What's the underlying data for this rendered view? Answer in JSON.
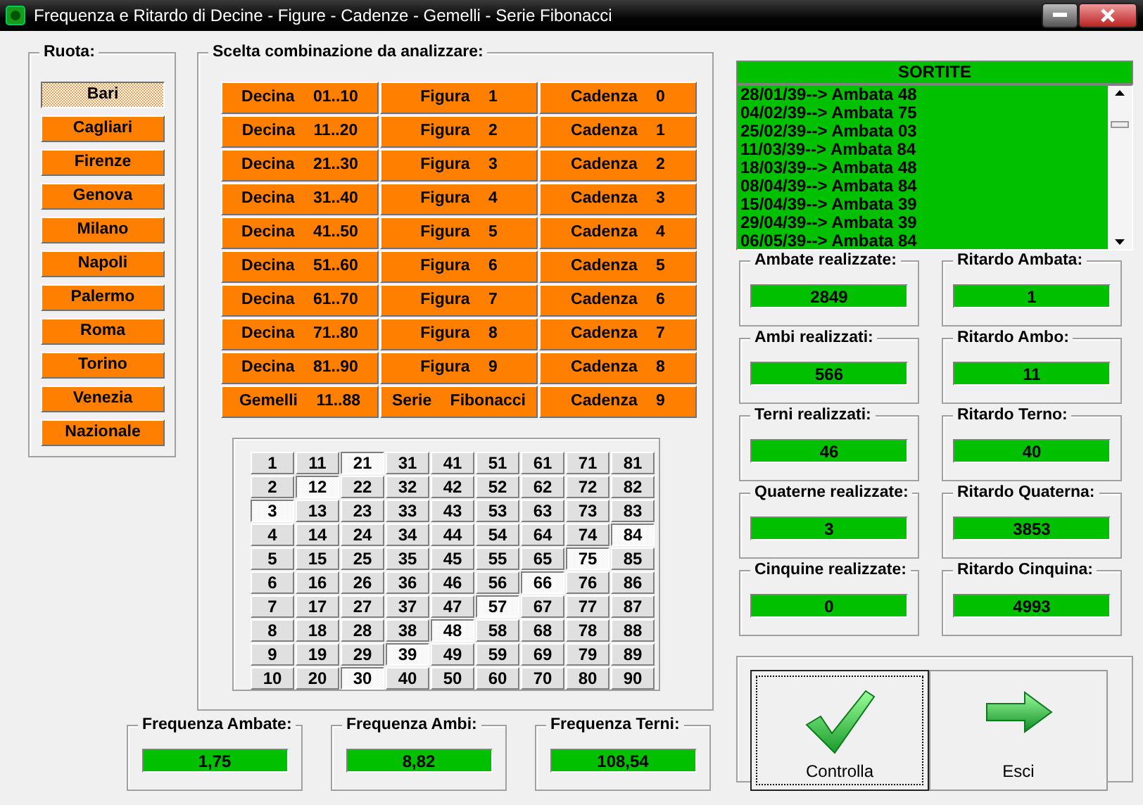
{
  "window": {
    "title": "Frequenza e Ritardo di Decine - Figure - Cadenze - Gemelli - Serie Fibonacci"
  },
  "ruota": {
    "label": "Ruota:",
    "items": [
      {
        "label": "Bari",
        "selected": true
      },
      {
        "label": "Cagliari",
        "selected": false
      },
      {
        "label": "Firenze",
        "selected": false
      },
      {
        "label": "Genova",
        "selected": false
      },
      {
        "label": "Milano",
        "selected": false
      },
      {
        "label": "Napoli",
        "selected": false
      },
      {
        "label": "Palermo",
        "selected": false
      },
      {
        "label": "Roma",
        "selected": false
      },
      {
        "label": "Torino",
        "selected": false
      },
      {
        "label": "Venezia",
        "selected": false
      },
      {
        "label": "Nazionale",
        "selected": false
      }
    ]
  },
  "scelta": {
    "label": "Scelta combinazione da analizzare:",
    "rows": [
      [
        "Decina 01..10",
        "Figura 1",
        "Cadenza 0"
      ],
      [
        "Decina 11..20",
        "Figura 2",
        "Cadenza 1"
      ],
      [
        "Decina 21..30",
        "Figura 3",
        "Cadenza 2"
      ],
      [
        "Decina 31..40",
        "Figura 4",
        "Cadenza 3"
      ],
      [
        "Decina 41..50",
        "Figura 5",
        "Cadenza 4"
      ],
      [
        "Decina 51..60",
        "Figura 6",
        "Cadenza 5"
      ],
      [
        "Decina 61..70",
        "Figura 7",
        "Cadenza 6"
      ],
      [
        "Decina 71..80",
        "Figura 8",
        "Cadenza 7"
      ],
      [
        "Decina 81..90",
        "Figura 9",
        "Cadenza 8"
      ],
      [
        "Gemelli 11..88",
        "Serie Fibonacci",
        "Cadenza 9"
      ]
    ]
  },
  "grid": {
    "rows": [
      {
        "cells": [
          {
            "text": "1",
            "selected": false
          },
          {
            "text": "11",
            "selected": false
          },
          {
            "text": "21",
            "selected": true
          },
          {
            "text": "31",
            "selected": false
          },
          {
            "text": "41",
            "selected": false
          },
          {
            "text": "51",
            "selected": false
          },
          {
            "text": "61",
            "selected": false
          },
          {
            "text": "71",
            "selected": false
          },
          {
            "text": "81",
            "selected": false
          }
        ]
      },
      {
        "cells": [
          {
            "text": "2",
            "selected": false
          },
          {
            "text": "12",
            "selected": true
          },
          {
            "text": "22",
            "selected": false
          },
          {
            "text": "32",
            "selected": false
          },
          {
            "text": "42",
            "selected": false
          },
          {
            "text": "52",
            "selected": false
          },
          {
            "text": "62",
            "selected": false
          },
          {
            "text": "72",
            "selected": false
          },
          {
            "text": "82",
            "selected": false
          }
        ]
      },
      {
        "cells": [
          {
            "text": "3",
            "selected": true
          },
          {
            "text": "13",
            "selected": false
          },
          {
            "text": "23",
            "selected": false
          },
          {
            "text": "33",
            "selected": false
          },
          {
            "text": "43",
            "selected": false
          },
          {
            "text": "53",
            "selected": false
          },
          {
            "text": "63",
            "selected": false
          },
          {
            "text": "73",
            "selected": false
          },
          {
            "text": "83",
            "selected": false
          }
        ]
      },
      {
        "cells": [
          {
            "text": "4",
            "selected": false
          },
          {
            "text": "14",
            "selected": false
          },
          {
            "text": "24",
            "selected": false
          },
          {
            "text": "34",
            "selected": false
          },
          {
            "text": "44",
            "selected": false
          },
          {
            "text": "54",
            "selected": false
          },
          {
            "text": "64",
            "selected": false
          },
          {
            "text": "74",
            "selected": false
          },
          {
            "text": "84",
            "selected": true
          }
        ]
      },
      {
        "cells": [
          {
            "text": "5",
            "selected": false
          },
          {
            "text": "15",
            "selected": false
          },
          {
            "text": "25",
            "selected": false
          },
          {
            "text": "35",
            "selected": false
          },
          {
            "text": "45",
            "selected": false
          },
          {
            "text": "55",
            "selected": false
          },
          {
            "text": "65",
            "selected": false
          },
          {
            "text": "75",
            "selected": true
          },
          {
            "text": "85",
            "selected": false
          }
        ]
      },
      {
        "cells": [
          {
            "text": "6",
            "selected": false
          },
          {
            "text": "16",
            "selected": false
          },
          {
            "text": "26",
            "selected": false
          },
          {
            "text": "36",
            "selected": false
          },
          {
            "text": "46",
            "selected": false
          },
          {
            "text": "56",
            "selected": false
          },
          {
            "text": "66",
            "selected": true
          },
          {
            "text": "76",
            "selected": false
          },
          {
            "text": "86",
            "selected": false
          }
        ]
      },
      {
        "cells": [
          {
            "text": "7",
            "selected": false
          },
          {
            "text": "17",
            "selected": false
          },
          {
            "text": "27",
            "selected": false
          },
          {
            "text": "37",
            "selected": false
          },
          {
            "text": "47",
            "selected": false
          },
          {
            "text": "57",
            "selected": true
          },
          {
            "text": "67",
            "selected": false
          },
          {
            "text": "77",
            "selected": false
          },
          {
            "text": "87",
            "selected": false
          }
        ]
      },
      {
        "cells": [
          {
            "text": "8",
            "selected": false
          },
          {
            "text": "18",
            "selected": false
          },
          {
            "text": "28",
            "selected": false
          },
          {
            "text": "38",
            "selected": false
          },
          {
            "text": "48",
            "selected": true
          },
          {
            "text": "58",
            "selected": false
          },
          {
            "text": "68",
            "selected": false
          },
          {
            "text": "78",
            "selected": false
          },
          {
            "text": "88",
            "selected": false
          }
        ]
      },
      {
        "cells": [
          {
            "text": "9",
            "selected": false
          },
          {
            "text": "19",
            "selected": false
          },
          {
            "text": "29",
            "selected": false
          },
          {
            "text": "39",
            "selected": true
          },
          {
            "text": "49",
            "selected": false
          },
          {
            "text": "59",
            "selected": false
          },
          {
            "text": "69",
            "selected": false
          },
          {
            "text": "79",
            "selected": false
          },
          {
            "text": "89",
            "selected": false
          }
        ]
      },
      {
        "cells": [
          {
            "text": "10",
            "selected": false
          },
          {
            "text": "20",
            "selected": false
          },
          {
            "text": "30",
            "selected": true
          },
          {
            "text": "40",
            "selected": false
          },
          {
            "text": "50",
            "selected": false
          },
          {
            "text": "60",
            "selected": false
          },
          {
            "text": "70",
            "selected": false
          },
          {
            "text": "80",
            "selected": false
          },
          {
            "text": "90",
            "selected": false
          }
        ]
      }
    ]
  },
  "frequenze": [
    {
      "label": "Frequenza Ambate:",
      "value": "1,75"
    },
    {
      "label": "Frequenza Ambi:",
      "value": "8,82"
    },
    {
      "label": "Frequenza Terni:",
      "value": "108,54"
    }
  ],
  "sortite": {
    "title": "SORTITE",
    "entries": [
      "28/01/39--> Ambata 48",
      "04/02/39--> Ambata 75",
      "25/02/39--> Ambata 03",
      "11/03/39--> Ambata 84",
      "18/03/39--> Ambata 48",
      "08/04/39--> Ambata 84",
      "15/04/39--> Ambata 39",
      "29/04/39--> Ambata 39",
      "06/05/39--> Ambata 84"
    ]
  },
  "stats": [
    {
      "label": "Ambate realizzate:",
      "value": "2849"
    },
    {
      "label": "Ritardo Ambata:",
      "value": "1"
    },
    {
      "label": "Ambi realizzati:",
      "value": "566"
    },
    {
      "label": "Ritardo Ambo:",
      "value": "11"
    },
    {
      "label": "Terni realizzati:",
      "value": "46"
    },
    {
      "label": "Ritardo Terno:",
      "value": "40"
    },
    {
      "label": "Quaterne realizzate:",
      "value": "3"
    },
    {
      "label": "Ritardo Quaterna:",
      "value": "3853"
    },
    {
      "label": "Cinquine realizzate:",
      "value": "0"
    },
    {
      "label": "Ritardo Cinquina:",
      "value": "4993"
    }
  ],
  "actions": [
    {
      "label": "Controlla",
      "kind": "check",
      "focused": true
    },
    {
      "label": "Esci",
      "kind": "exit",
      "focused": false
    }
  ]
}
